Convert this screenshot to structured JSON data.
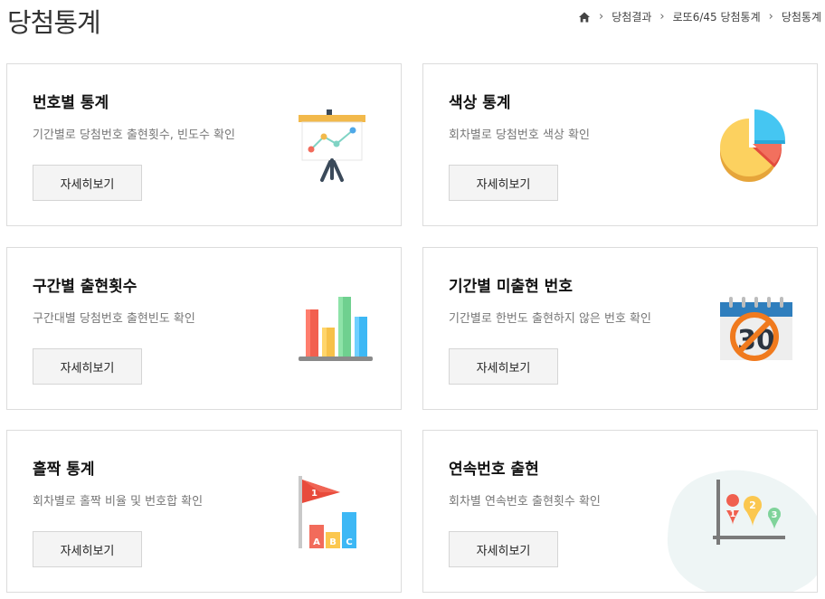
{
  "page": {
    "title": "당첨통계"
  },
  "breadcrumb": {
    "home_icon": "home-icon",
    "items": [
      "당첨결과",
      "로또6/45 당첨통계",
      "당첨통계"
    ]
  },
  "cards": [
    {
      "title": "번호별 통계",
      "description": "기간별로 당첨번호 출현횟수, 빈도수 확인",
      "button_label": "자세히보기",
      "icon": "presentation-board-icon"
    },
    {
      "title": "색상 통계",
      "description": "회차별로 당첨번호 색상 확인",
      "button_label": "자세히보기",
      "icon": "pie-chart-icon"
    },
    {
      "title": "구간별 출현횟수",
      "description": "구간대별 당첨번호 출현빈도 확인",
      "button_label": "자세히보기",
      "icon": "bar-chart-icon"
    },
    {
      "title": "기간별 미출현 번호",
      "description": "기간별로 한번도 출현하지 않은 번호 확인",
      "button_label": "자세히보기",
      "icon": "calendar-prohibited-icon",
      "icon_text": "30"
    },
    {
      "title": "홀짝 통계",
      "description": "회차별로 홀짝 비율 및 번호합 확인",
      "button_label": "자세히보기",
      "icon": "flag-bar-chart-icon",
      "icon_texts": [
        "1",
        "A",
        "B",
        "C"
      ]
    },
    {
      "title": "연속번호 출현",
      "description": "회차별 연속번호 출현횟수 확인",
      "button_label": "자세히보기",
      "icon": "map-pin-graph-icon",
      "icon_texts": [
        "1",
        "2",
        "3"
      ]
    }
  ]
}
